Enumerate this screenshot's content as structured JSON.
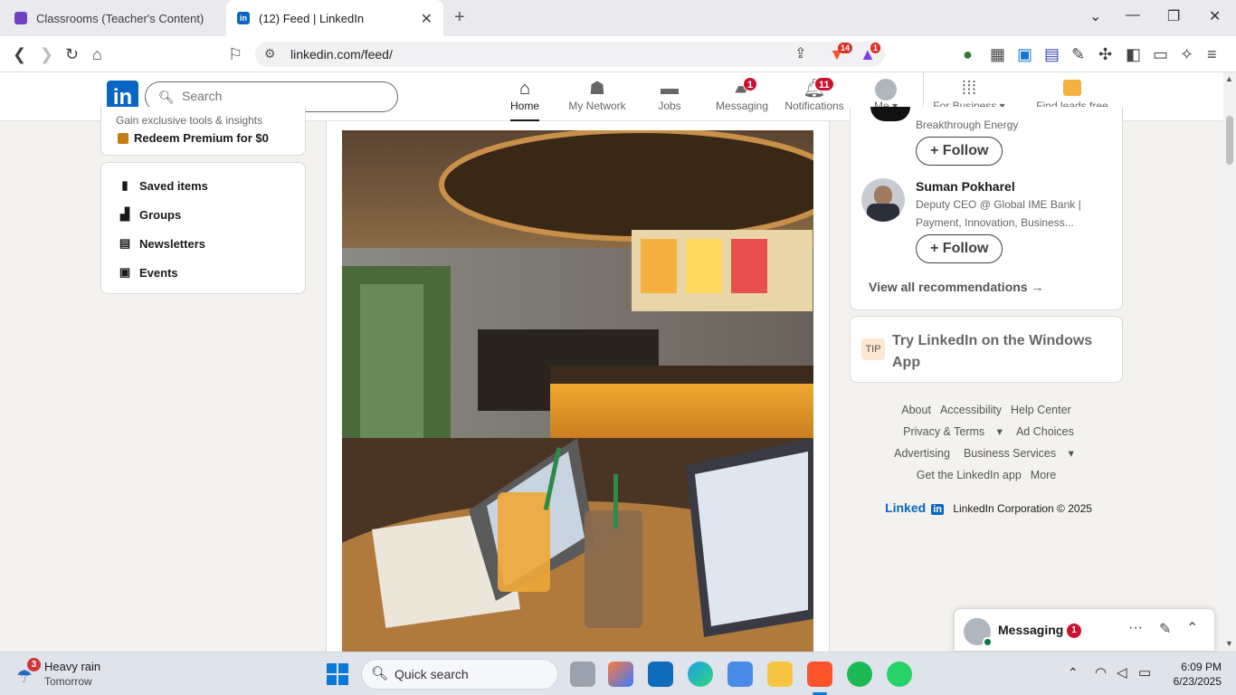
{
  "browser": {
    "tabs": [
      {
        "title": "Classrooms (Teacher's Content) | Stud",
        "active": false
      },
      {
        "title": "(12) Feed | LinkedIn",
        "active": true
      }
    ],
    "url": "linkedin.com/feed/",
    "brave_badge": "14",
    "rewards_badge": "1"
  },
  "linkedin": {
    "logo": "in",
    "search_placeholder": "Search",
    "nav": [
      {
        "label": "Home",
        "icon": "home-icon",
        "badge": ""
      },
      {
        "label": "My Network",
        "icon": "network-icon",
        "badge": ""
      },
      {
        "label": "Jobs",
        "icon": "briefcase-icon",
        "badge": ""
      },
      {
        "label": "Messaging",
        "icon": "messaging-icon",
        "badge": "1"
      },
      {
        "label": "Notifications",
        "icon": "bell-icon",
        "badge": "11"
      },
      {
        "label": "Me",
        "icon": "avatar-icon",
        "badge": ""
      },
      {
        "label": "For Business",
        "icon": "grid-icon",
        "badge": ""
      },
      {
        "label": "Find leads free",
        "icon": "leads-icon",
        "badge": ""
      }
    ],
    "left": {
      "premium_teaser": "Gain exclusive tools & insights",
      "premium_link": "Redeem Premium for $0",
      "shortcuts": [
        "Saved items",
        "Groups",
        "Newsletters",
        "Events"
      ]
    },
    "right": {
      "rec1_subtitle": "Breakthrough Energy",
      "follow_label": "Follow",
      "rec2_name": "Suman Pokharel",
      "rec2_line1": "Deputy CEO @ Global IME Bank |",
      "rec2_line2": "Payment, Innovation, Business...",
      "view_all": "View all recommendations",
      "tip_badge": "TIP",
      "tip_line1": "Try LinkedIn on the Windows",
      "tip_line2": "App"
    },
    "footer": {
      "row1": [
        "About",
        "Accessibility",
        "Help Center"
      ],
      "row2": [
        "Privacy & Terms",
        "Ad Choices"
      ],
      "row3": [
        "Advertising",
        "Business Services"
      ],
      "row4": [
        "Get the LinkedIn app",
        "More"
      ],
      "brand": "Linked",
      "brand_in": "in",
      "copyright": "LinkedIn Corporation © 2025"
    },
    "messaging": {
      "label": "Messaging",
      "badge": "1"
    }
  },
  "taskbar": {
    "weather_badge": "3",
    "weather_title": "Heavy rain",
    "weather_sub": "Tomorrow",
    "search": "Quick search",
    "time": "6:09 PM",
    "date": "6/23/2025"
  }
}
